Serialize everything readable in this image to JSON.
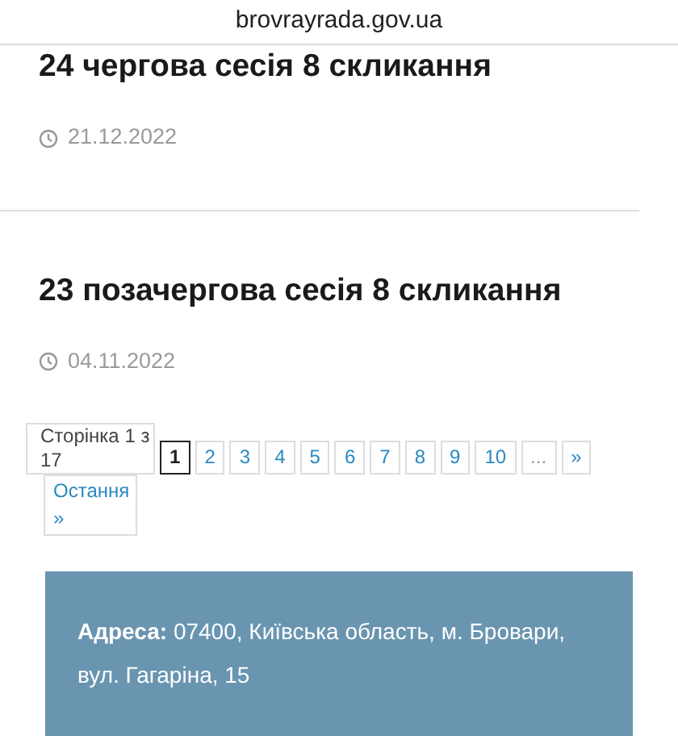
{
  "address_bar": {
    "url": "brovrayrada.gov.ua"
  },
  "posts": [
    {
      "title": "24 чергова сесія 8 скликання",
      "date": "21.12.2022"
    },
    {
      "title": "23 позачергова сесія 8 скликання",
      "date": "04.11.2022"
    }
  ],
  "pagination": {
    "info": "Сторінка 1 з 17",
    "items": [
      {
        "kind": "page",
        "label": "1",
        "selected": true
      },
      {
        "kind": "page",
        "label": "2",
        "selected": false
      },
      {
        "kind": "page",
        "label": "3",
        "selected": false
      },
      {
        "kind": "page",
        "label": "4",
        "selected": false
      },
      {
        "kind": "page",
        "label": "5",
        "selected": false
      },
      {
        "kind": "page",
        "label": "6",
        "selected": false
      },
      {
        "kind": "page",
        "label": "7",
        "selected": false
      },
      {
        "kind": "page",
        "label": "8",
        "selected": false
      },
      {
        "kind": "page",
        "label": "9",
        "selected": false
      },
      {
        "kind": "page",
        "label": "10",
        "selected": false
      },
      {
        "kind": "gap",
        "label": "..."
      },
      {
        "kind": "next",
        "label": "»"
      },
      {
        "kind": "last",
        "label": "Остання »"
      }
    ]
  },
  "footer": {
    "address": "**Адреса:** 07400, Київська область, м. Бровари, вул. Гагаріна, 15"
  }
}
